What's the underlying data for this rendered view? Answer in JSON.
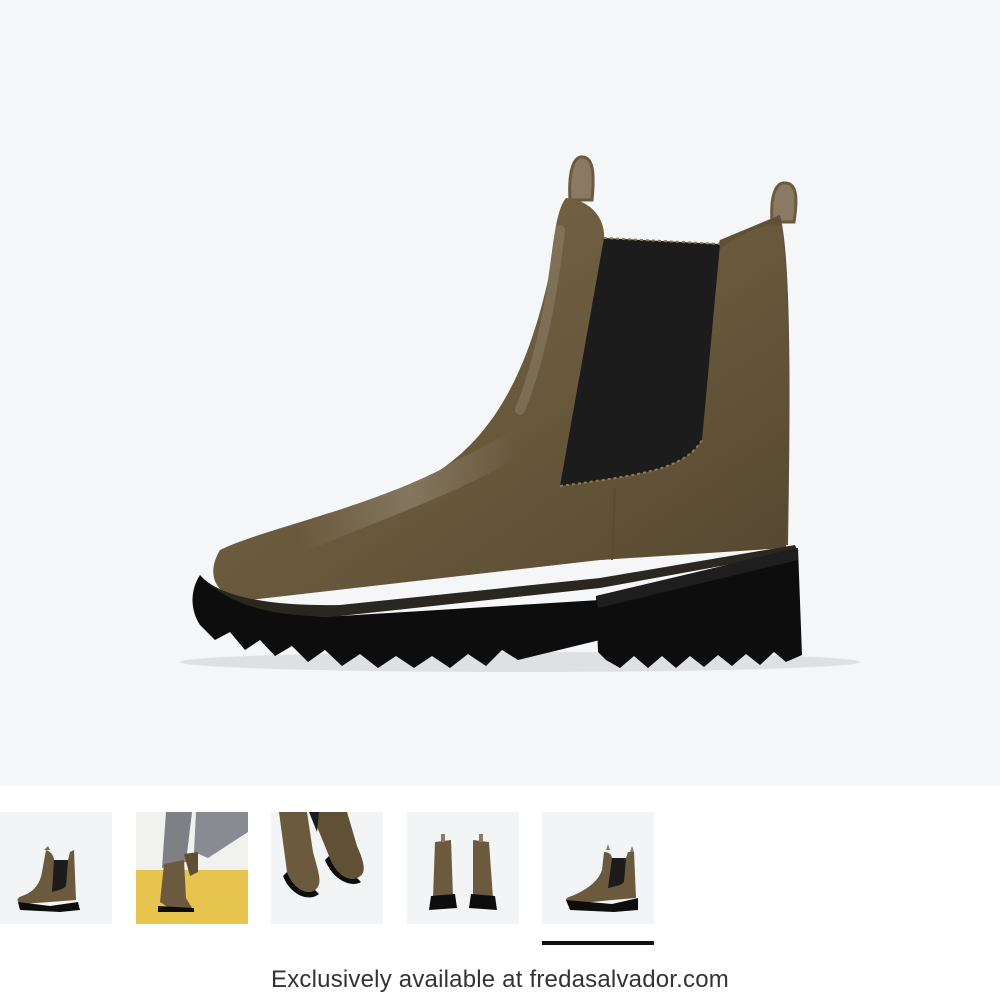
{
  "product": {
    "main_image": "chelsea-boot-olive-side-view",
    "colors": {
      "leather": "#6b5a3e",
      "elastic": "#1c1c1c",
      "sole": "#0d0d0d",
      "background": "#f5f6f8"
    }
  },
  "gallery": {
    "thumbnails": [
      {
        "image": "boot-side-thumb",
        "active": false
      },
      {
        "image": "boot-on-model-thumb",
        "active": false
      },
      {
        "image": "boot-pair-top-thumb",
        "active": false
      },
      {
        "image": "boot-pair-back-thumb",
        "active": false
      },
      {
        "image": "boot-side-alt-thumb",
        "active": true
      }
    ],
    "active_index": 4
  },
  "footer": {
    "caption": "Exclusively available at fredasalvador.com"
  }
}
